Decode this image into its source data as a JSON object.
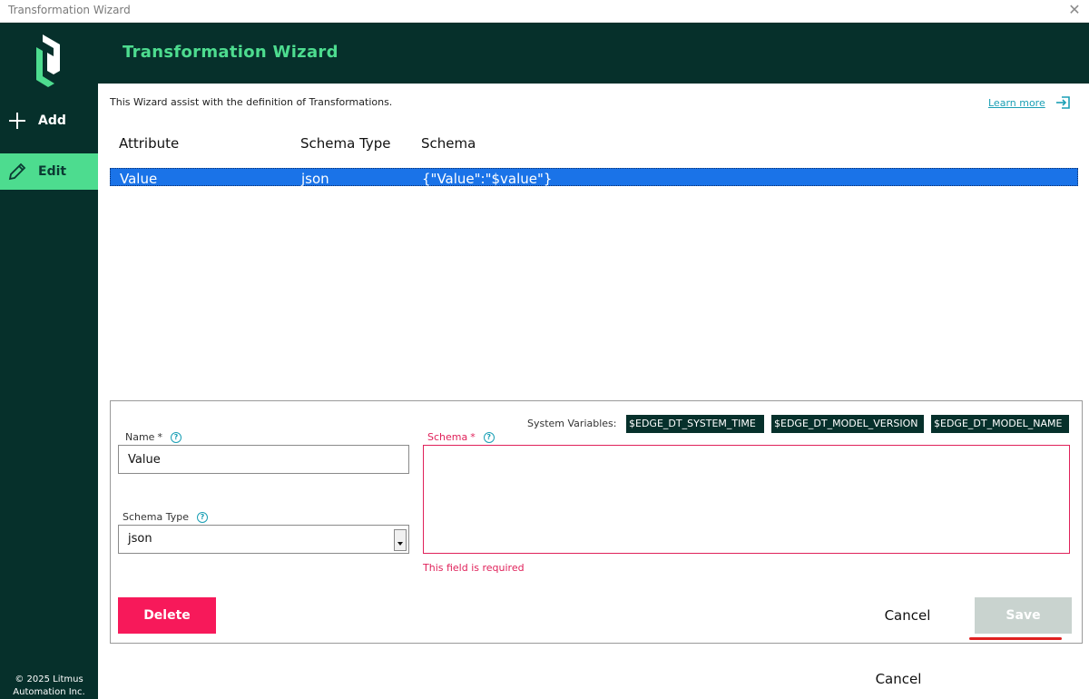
{
  "window": {
    "title": "Transformation Wizard",
    "close_glyph": "✕"
  },
  "sidebar": {
    "items": [
      {
        "label": "Add",
        "icon": "plus-icon"
      },
      {
        "label": "Edit",
        "icon": "pencil-icon",
        "active": true
      }
    ],
    "copyright_line1": "© 2025 Litmus",
    "copyright_line2": "Automation Inc."
  },
  "header": {
    "title": "Transformation Wizard"
  },
  "intro": {
    "text": "This Wizard assist with the definition of Transformations.",
    "learn_more": "Learn more"
  },
  "table": {
    "columns": [
      "Attribute",
      "Schema Type",
      "Schema"
    ],
    "rows": [
      {
        "attribute": "Value",
        "schema_type": "json",
        "schema": "{\"Value\":\"$value\"}"
      }
    ]
  },
  "form": {
    "system_variables_label": "System Variables:",
    "system_variables": [
      "$EDGE_DT_SYSTEM_TIME",
      "$EDGE_DT_MODEL_VERSION",
      "$EDGE_DT_MODEL_NAME"
    ],
    "name_label": "Name",
    "name_value": "Value",
    "schema_label": "Schema",
    "required_mark": "*",
    "help_glyph": "?",
    "schema_type_label": "Schema Type",
    "schema_type_value": "json",
    "schema_value": "",
    "error_text": "This field is required",
    "delete_label": "Delete",
    "cancel_label": "Cancel",
    "save_label": "Save"
  },
  "footer": {
    "cancel_label": "Cancel"
  },
  "colors": {
    "dark": "#06302b",
    "accent": "#4ddc8f",
    "danger": "#f7195a",
    "link": "#1a9fb5",
    "selection": "#1a73e8"
  }
}
